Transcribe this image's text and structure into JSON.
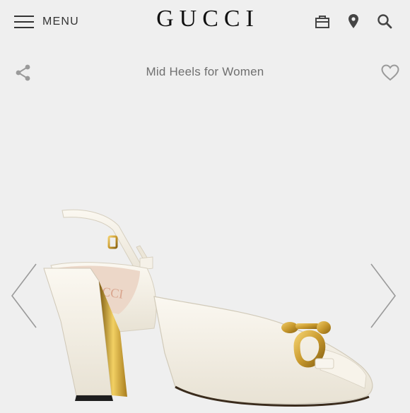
{
  "header": {
    "menu_label": "MENU",
    "brand": "GUCCI",
    "icons": [
      "shopping-bag-icon",
      "location-pin-icon",
      "search-icon"
    ]
  },
  "subheader": {
    "title": "Mid Heels for Women",
    "left_icon": "share-icon",
    "right_icon": "heart-icon"
  },
  "gallery": {
    "image": "white-leather-slingback-mid-heel-with-gold-horsebit",
    "prev_icon": "chevron-left-icon",
    "next_icon": "chevron-right-icon"
  },
  "colors": {
    "background": "#efefef",
    "shoe_leather": "#f4f0e6",
    "gold_hardware": "#c99a2e",
    "icon_gray": "#9a9a9a"
  }
}
